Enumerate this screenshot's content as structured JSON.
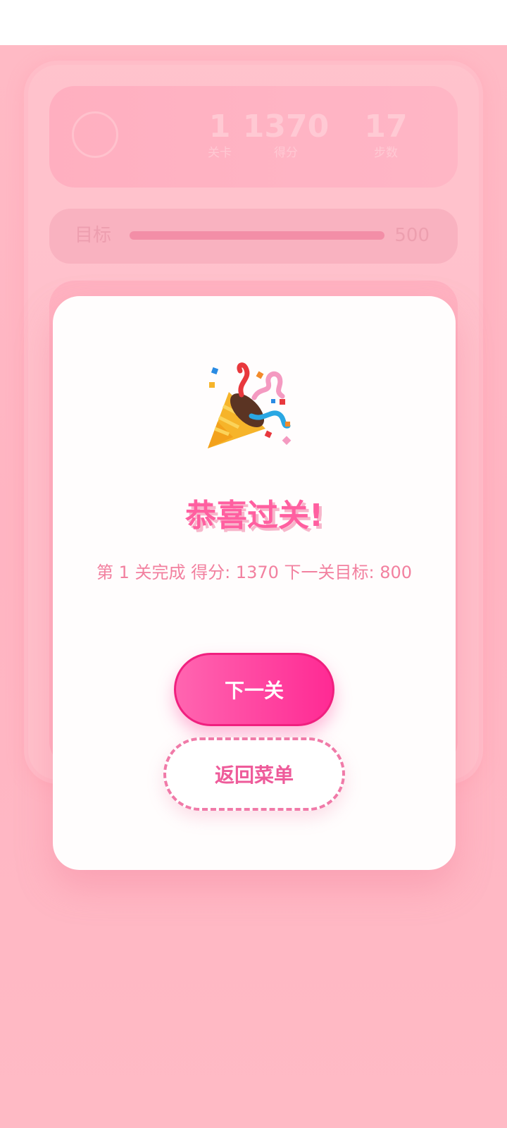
{
  "stats": {
    "level": {
      "value": "1",
      "label": "关卡"
    },
    "score": {
      "value": "1370",
      "label": "得分"
    },
    "moves": {
      "value": "17",
      "label": "步数"
    }
  },
  "target": {
    "label": "目标",
    "value": "500",
    "progress_fraction": 1.0
  },
  "modal": {
    "icon": "party-popper-icon",
    "title": "恭喜过关!",
    "message": "第 1 关完成 得分: 1370 下一关目标: 800",
    "next_button": "下一关",
    "menu_button": "返回菜单"
  },
  "colors": {
    "accent": "#ff2a94",
    "title_pink": "#ff5fa0",
    "background_pink": "#ffb6c3"
  }
}
